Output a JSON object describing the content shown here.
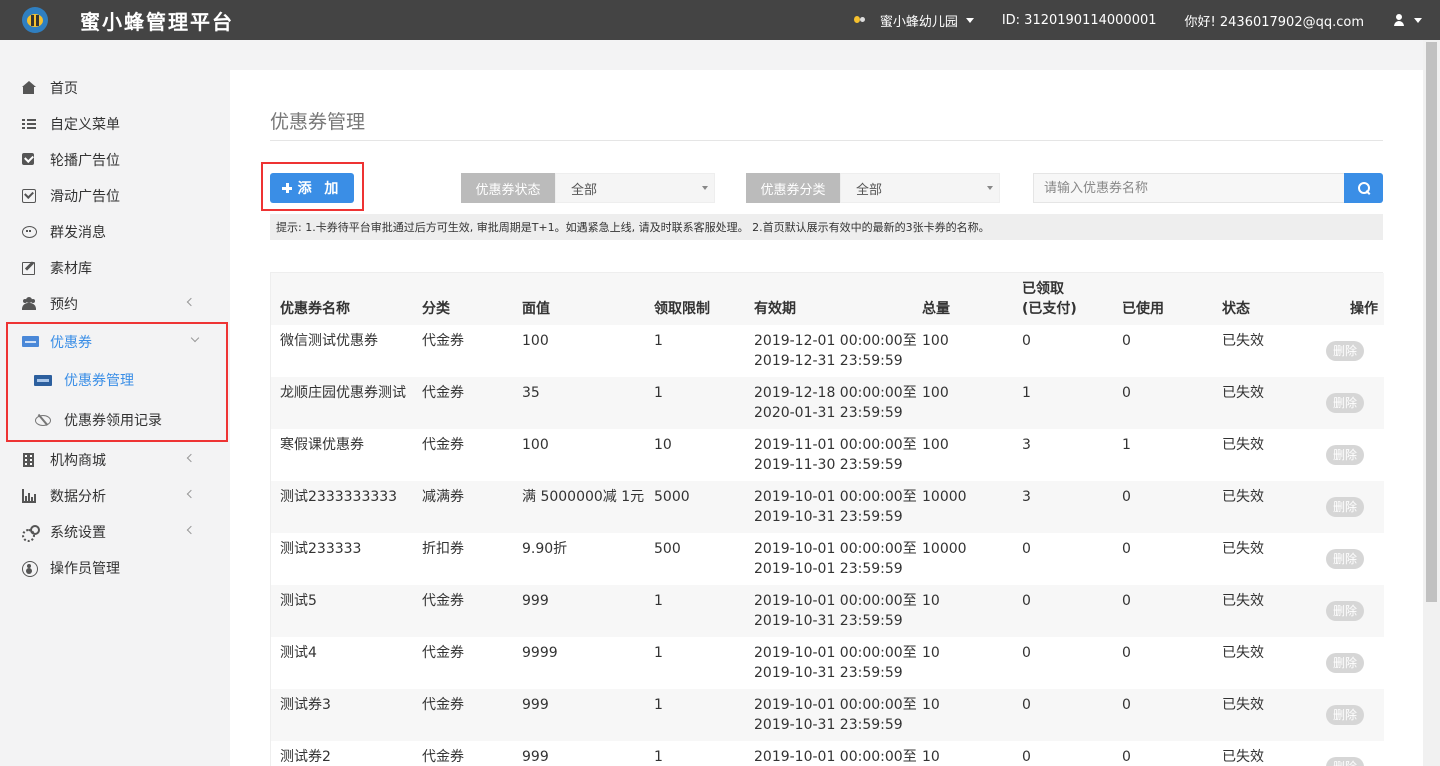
{
  "app": {
    "title": "蜜小蜂管理平台",
    "org": "蜜小蜂幼儿园",
    "id_text": "ID:  3120190114000001",
    "greeting": "你好! 2436017902@qq.com"
  },
  "sidebar": {
    "items": [
      {
        "label": "首页",
        "icon": "home-icon"
      },
      {
        "label": "自定义菜单",
        "icon": "list-icon"
      },
      {
        "label": "轮播广告位",
        "icon": "check-square-icon"
      },
      {
        "label": "滑动广告位",
        "icon": "check-square-o-icon"
      },
      {
        "label": "群发消息",
        "icon": "comment-icon"
      },
      {
        "label": "素材库",
        "icon": "edit-icon"
      },
      {
        "label": "预约",
        "icon": "users-icon"
      },
      {
        "label": "优惠券",
        "icon": "card-icon"
      },
      {
        "label": "机构商城",
        "icon": "building-icon"
      },
      {
        "label": "数据分析",
        "icon": "bar-chart-icon"
      },
      {
        "label": "系统设置",
        "icon": "cogs-icon"
      },
      {
        "label": "操作员管理",
        "icon": "user-circle-icon"
      }
    ],
    "coupon_sub": [
      {
        "label": "优惠券管理"
      },
      {
        "label": "优惠券领用记录"
      }
    ]
  },
  "main": {
    "page_title": "优惠券管理",
    "add_label": "添 加",
    "filter_status": {
      "label": "优惠券状态",
      "value": "全部"
    },
    "filter_category": {
      "label": "优惠券分类",
      "value": "全部"
    },
    "search_placeholder": "请输入优惠券名称",
    "tip": "提示: 1.卡券待平台审批通过后方可生效, 审批周期是T+1。如遇紧急上线, 请及时联系客服处理。 2.首页默认展示有效中的最新的3张卡券的名称。"
  },
  "table": {
    "headers": {
      "name": "优惠券名称",
      "category": "分类",
      "value": "面值",
      "limit": "领取限制",
      "validity": "有效期",
      "total": "总量",
      "received_1": "已领取",
      "received_2": "(已支付)",
      "used": "已使用",
      "status": "状态",
      "op": "操作"
    },
    "delete_label": "删除",
    "rows": [
      {
        "name": "微信测试优惠券",
        "category": "代金券",
        "value": "100",
        "limit": "1",
        "start": "2019-12-01 00:00:00至",
        "end": "2019-12-31 23:59:59",
        "total": "100",
        "received": "0",
        "used": "0",
        "status": "已失效"
      },
      {
        "name": "龙顺庄园优惠券测试",
        "category": "代金券",
        "value": "35",
        "limit": "1",
        "start": "2019-12-18 00:00:00至",
        "end": "2020-01-31 23:59:59",
        "total": "100",
        "received": "1",
        "used": "0",
        "status": "已失效"
      },
      {
        "name": "寒假课优惠券",
        "category": "代金券",
        "value": "100",
        "limit": "10",
        "start": "2019-11-01 00:00:00至",
        "end": "2019-11-30 23:59:59",
        "total": "100",
        "received": "3",
        "used": "1",
        "status": "已失效"
      },
      {
        "name": "测试2333333333",
        "category": "减满券",
        "value": "满 5000000减 1元",
        "limit": "5000",
        "start": "2019-10-01 00:00:00至",
        "end": "2019-10-31 23:59:59",
        "total": "10000",
        "received": "3",
        "used": "0",
        "status": "已失效"
      },
      {
        "name": "测试233333",
        "category": "折扣券",
        "value": "9.90折",
        "limit": "500",
        "start": "2019-10-01 00:00:00至",
        "end": "2019-10-01 23:59:59",
        "total": "10000",
        "received": "0",
        "used": "0",
        "status": "已失效"
      },
      {
        "name": "测试5",
        "category": "代金券",
        "value": "999",
        "limit": "1",
        "start": "2019-10-01 00:00:00至",
        "end": "2019-10-31 23:59:59",
        "total": "10",
        "received": "0",
        "used": "0",
        "status": "已失效"
      },
      {
        "name": "测试4",
        "category": "代金券",
        "value": "9999",
        "limit": "1",
        "start": "2019-10-01 00:00:00至",
        "end": "2019-10-31 23:59:59",
        "total": "10",
        "received": "0",
        "used": "0",
        "status": "已失效"
      },
      {
        "name": "测试券3",
        "category": "代金券",
        "value": "999",
        "limit": "1",
        "start": "2019-10-01 00:00:00至",
        "end": "2019-10-31 23:59:59",
        "total": "10",
        "received": "0",
        "used": "0",
        "status": "已失效"
      },
      {
        "name": "测试券2",
        "category": "代金券",
        "value": "999",
        "limit": "1",
        "start": "2019-10-01 00:00:00至",
        "end": "",
        "total": "10",
        "received": "0",
        "used": "0",
        "status": "已失效"
      }
    ]
  },
  "colors": {
    "topbar": "#444444",
    "accent": "#3a8ee6",
    "highlight_border": "#ee3333"
  }
}
